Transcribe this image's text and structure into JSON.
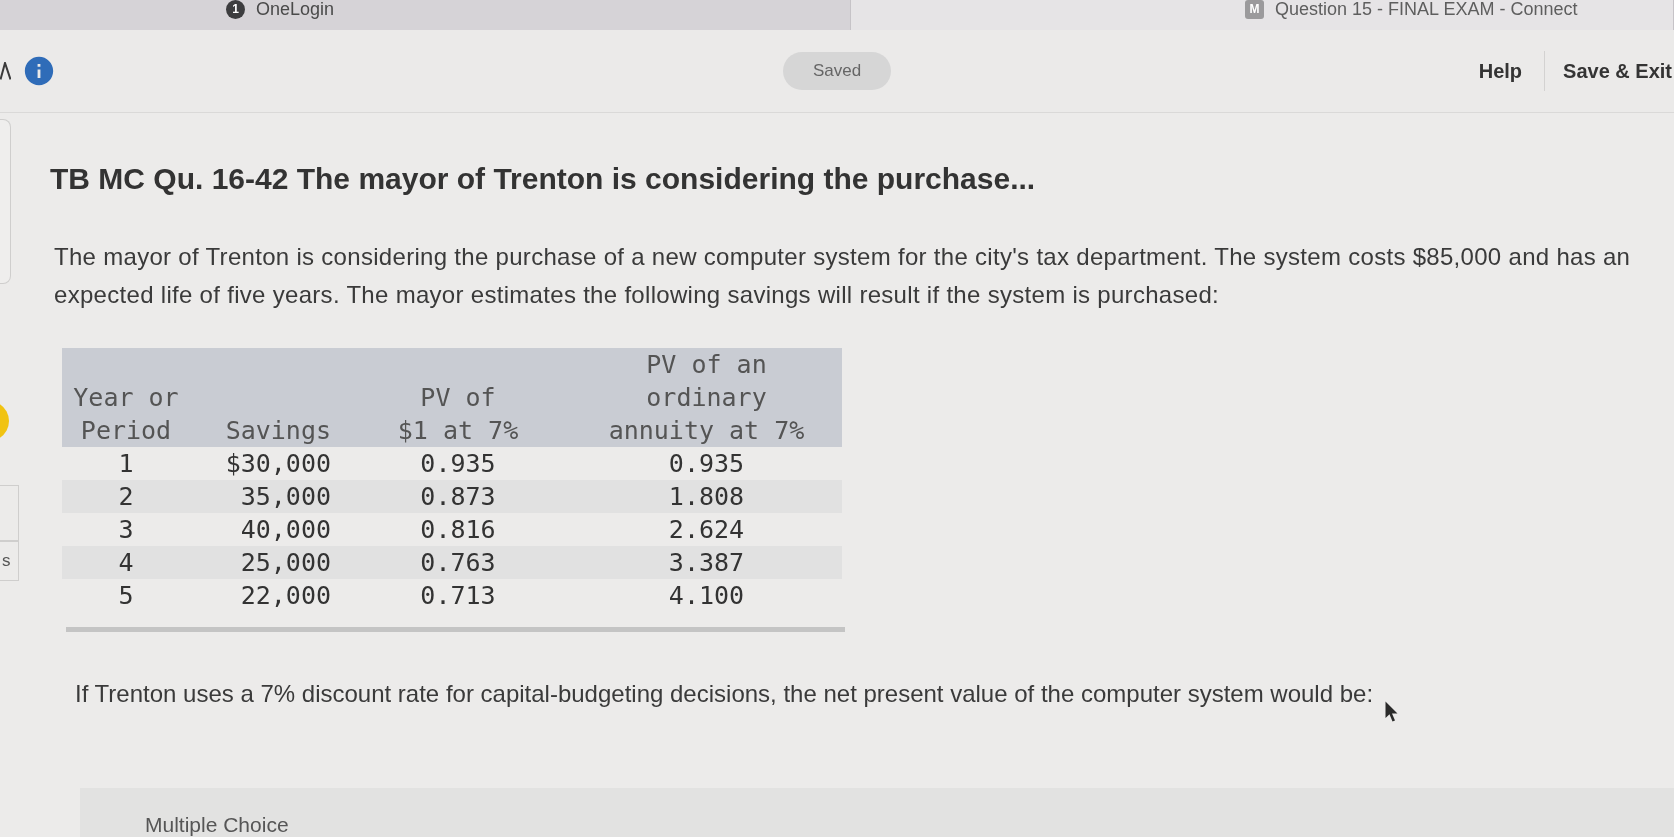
{
  "browser_tabs": [
    {
      "favicon": "1",
      "title": "OneLogin",
      "selected": false
    },
    {
      "favicon": "M",
      "title": "Question 15 - FINAL EXAM - Connect",
      "selected": true
    }
  ],
  "header": {
    "status": "Saved",
    "actions": [
      "Help",
      "Save & Exit"
    ]
  },
  "side_rail": {
    "label": "s"
  },
  "question": {
    "title": "TB MC Qu. 16-42 The mayor of Trenton is considering the purchase...",
    "intro": "The mayor of Trenton is considering the purchase of a new computer system for the city's tax department. The system costs $85,000 and has an expected life of five years. The mayor estimates the following savings will result if the system is purchased:",
    "table": {
      "columns": [
        "Year or\nPeriod",
        "Savings",
        "PV of\n$1 at 7%",
        "PV of an\nordinary\nannuity at 7%"
      ],
      "rows": [
        [
          "1",
          "$30,000",
          "0.935",
          "0.935"
        ],
        [
          "2",
          "35,000",
          "0.873",
          "1.808"
        ],
        [
          "3",
          "40,000",
          "0.816",
          "2.624"
        ],
        [
          "4",
          "25,000",
          "0.763",
          "3.387"
        ],
        [
          "5",
          "22,000",
          "0.713",
          "4.100"
        ]
      ]
    },
    "prompt": "If Trenton uses a 7% discount rate for capital-budgeting decisions, the net present value of the computer system would be:"
  },
  "answer_section": {
    "label": "Multiple Choice"
  }
}
